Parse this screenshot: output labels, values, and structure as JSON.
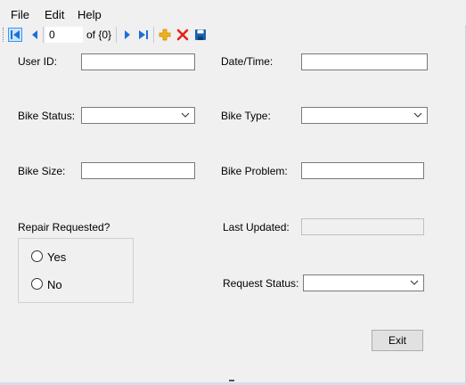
{
  "menu": {
    "items": [
      {
        "label": "File"
      },
      {
        "label": "Edit"
      },
      {
        "label": "Help"
      }
    ]
  },
  "navigator": {
    "position": "0",
    "count_label": "of {0}",
    "icons": [
      "move-first-icon",
      "move-previous-icon",
      "move-next-icon",
      "move-last-icon",
      "add-new-icon",
      "delete-icon",
      "save-icon"
    ]
  },
  "form": {
    "user_id": {
      "label": "User ID:",
      "value": ""
    },
    "date_time": {
      "label": "Date/Time:",
      "value": ""
    },
    "bike_status": {
      "label": "Bike Status:",
      "value": ""
    },
    "bike_type": {
      "label": "Bike Type:",
      "value": ""
    },
    "bike_size": {
      "label": "Bike Size:",
      "value": ""
    },
    "bike_problem": {
      "label": "Bike Problem:",
      "value": ""
    },
    "repair_requested": {
      "label": "Repair Requested?",
      "options": [
        {
          "label": "Yes",
          "selected": false
        },
        {
          "label": "No",
          "selected": false
        }
      ]
    },
    "last_updated": {
      "label": "Last Updated:",
      "value": ""
    },
    "request_status": {
      "label": "Request Status:",
      "value": ""
    },
    "exit_label": "Exit"
  },
  "colors": {
    "accent": "#1e6fd9",
    "delete": "#e2231a",
    "add": "#f2b21b"
  }
}
